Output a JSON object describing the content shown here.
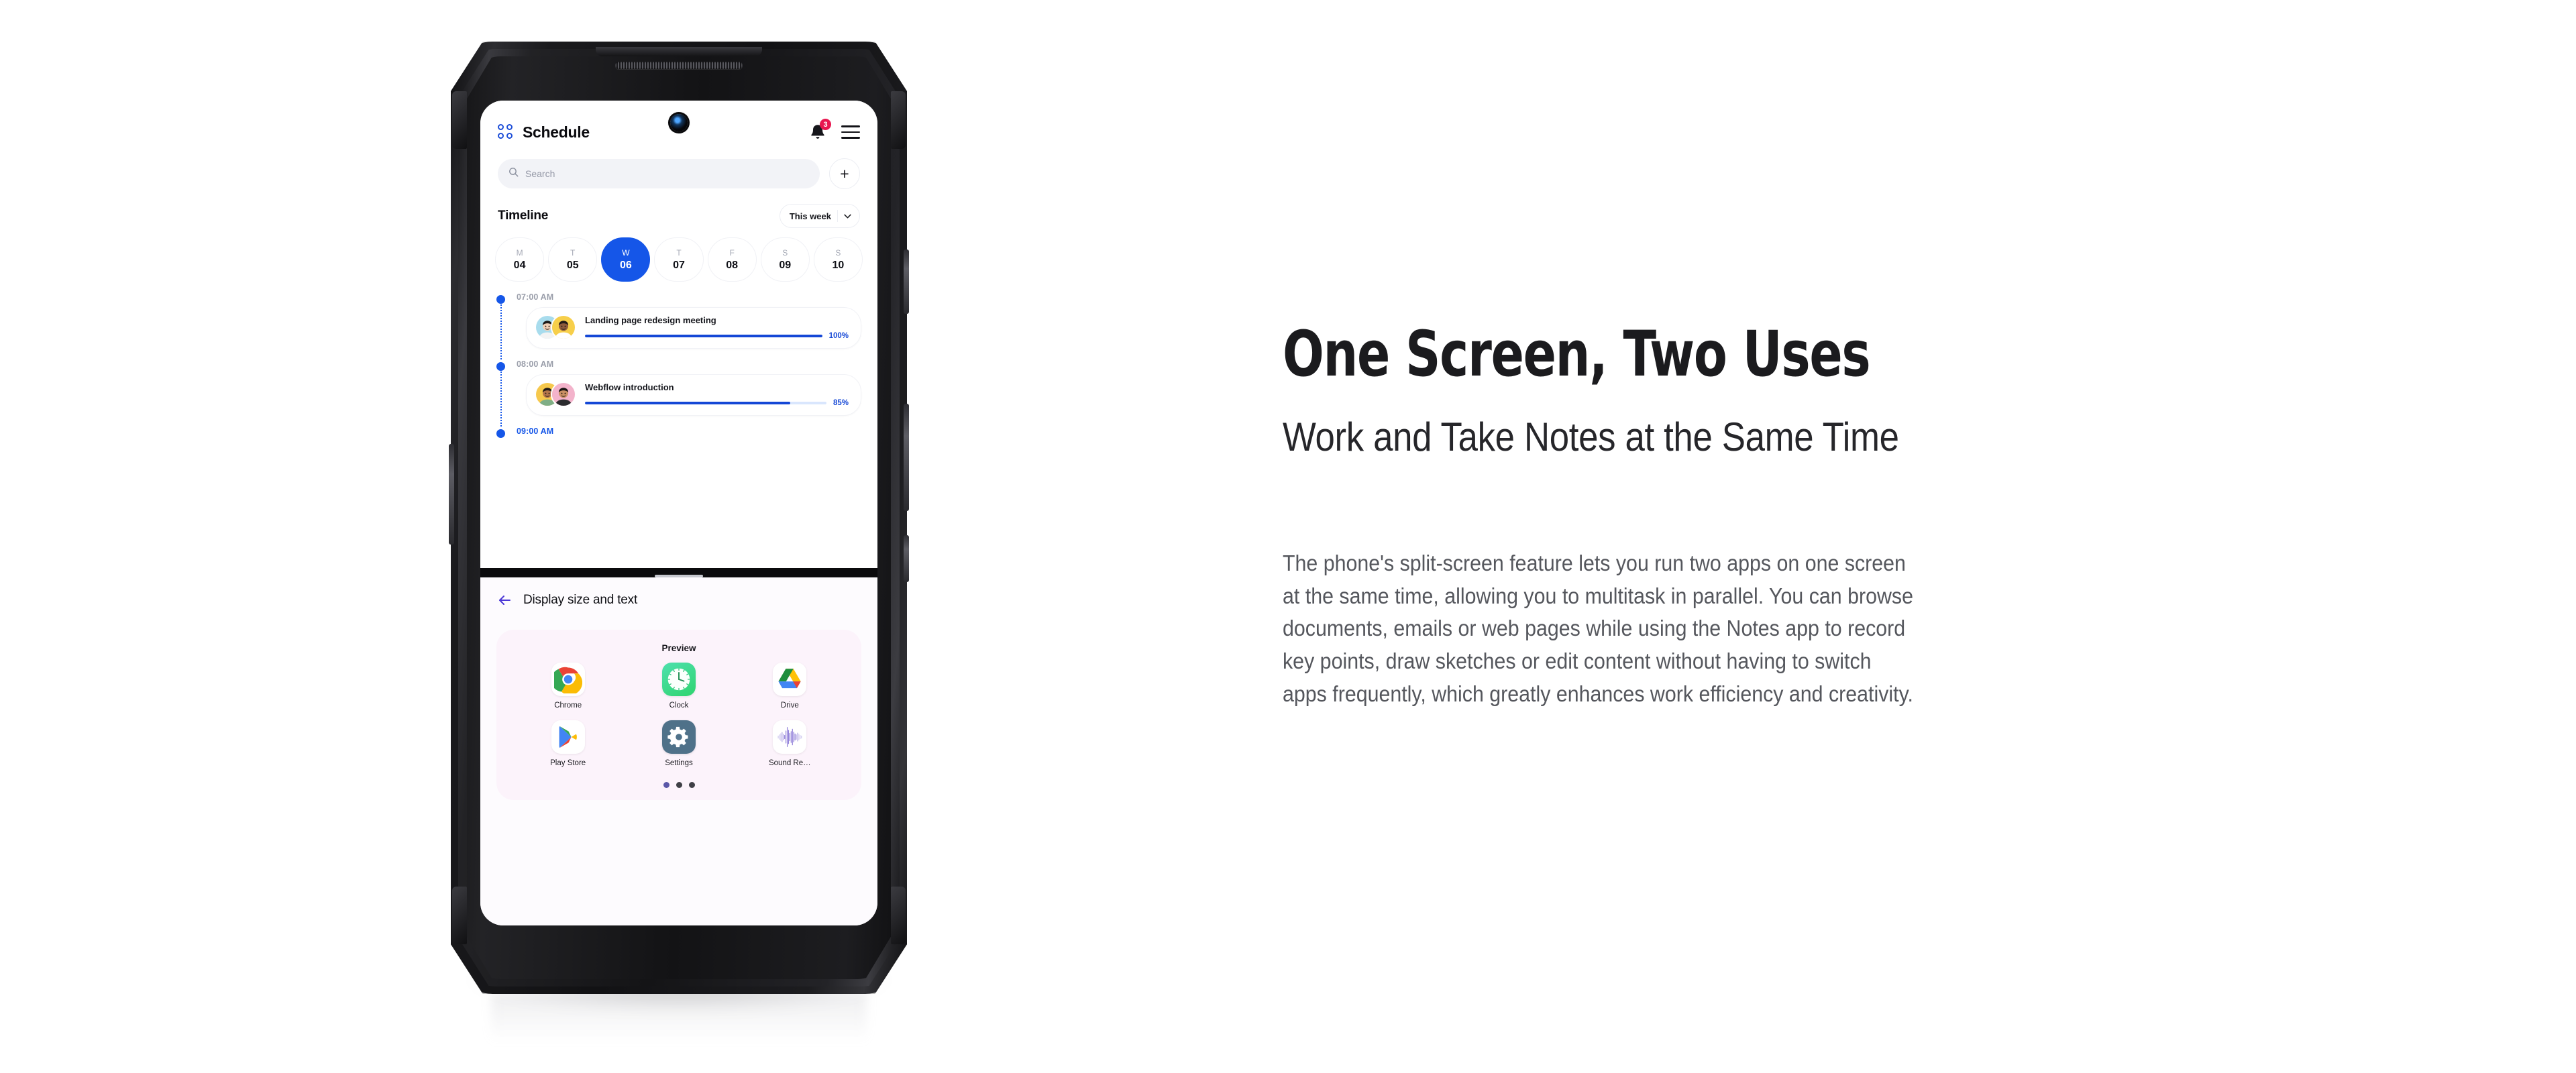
{
  "hero": {
    "title": "One Screen, Two Uses",
    "subtitle": "Work and Take Notes at the Same Time",
    "body": "The phone's split-screen feature lets you run two apps on one screen at the same time, allowing you to multitask in parallel. You can browse documents, emails or web pages while using the Notes app to record key points, draw sketches or edit content without having to switch apps frequently, which greatly enhances work efficiency and creativity."
  },
  "phone": {
    "top_app": {
      "header": {
        "app_title": "Schedule",
        "grid_icon": "grid-dots-icon",
        "bell_icon": "bell-icon",
        "notification_count": "3",
        "menu_icon": "hamburger-icon"
      },
      "search": {
        "placeholder": "Search",
        "search_icon": "search-icon",
        "add_label": "+"
      },
      "timeline": {
        "section_title": "Timeline",
        "range_label": "This week",
        "chevron": "⌄",
        "days": [
          {
            "weekday": "M",
            "date": "04",
            "active": false
          },
          {
            "weekday": "T",
            "date": "05",
            "active": false
          },
          {
            "weekday": "W",
            "date": "06",
            "active": true
          },
          {
            "weekday": "T",
            "date": "07",
            "active": false
          },
          {
            "weekday": "F",
            "date": "08",
            "active": false
          },
          {
            "weekday": "S",
            "date": "09",
            "active": false
          },
          {
            "weekday": "S",
            "date": "10",
            "active": false
          }
        ],
        "slots": [
          {
            "time": "07:00 AM",
            "strong": false,
            "event": {
              "title": "Landing page redesign meeting",
              "progress": "100%",
              "progress_value": 100,
              "avatar_colors": [
                "#a8dced",
                "#f7cf4a"
              ]
            }
          },
          {
            "time": "08:00 AM",
            "strong": false,
            "event": {
              "title": "Webflow introduction",
              "progress": "85%",
              "progress_value": 85,
              "avatar_colors": [
                "#f6c84c",
                "#f3b3cb"
              ]
            }
          },
          {
            "time": "09:00 AM",
            "strong": true,
            "event": null
          }
        ]
      }
    },
    "bottom_app": {
      "back_icon": "back-arrow-icon",
      "title": "Display size and text",
      "preview_label": "Preview",
      "apps": [
        {
          "label": "Chrome",
          "icon": "chrome-icon"
        },
        {
          "label": "Clock",
          "icon": "clock-icon"
        },
        {
          "label": "Drive",
          "icon": "google-drive-icon"
        },
        {
          "label": "Play Store",
          "icon": "play-store-icon"
        },
        {
          "label": "Settings",
          "icon": "gear-icon"
        },
        {
          "label": "Sound Re…",
          "icon": "sound-recorder-icon"
        }
      ],
      "page_dots": {
        "count": 3,
        "active_index": 0
      }
    }
  },
  "colors": {
    "accent_blue": "#1556e8",
    "progress_blue": "#1447d6",
    "badge_red": "#e8174f",
    "settings_bg": "#fcf3fb",
    "dot_active": "#5b57a8"
  }
}
